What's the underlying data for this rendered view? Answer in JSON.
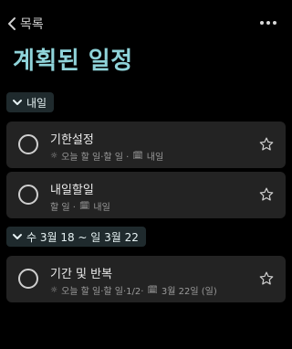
{
  "nav": {
    "back_label": "목록",
    "more_icon": "more-icon"
  },
  "page": {
    "title": "계획된 일정",
    "accent_color": "#8fd3d9"
  },
  "groups": [
    {
      "label": "내일",
      "tasks": [
        {
          "title": "기한설정",
          "meta_text": "오늘 할 일·할 일 ·",
          "due": "내일"
        },
        {
          "title": "내일할일",
          "meta_text": "할 일 ·",
          "due": "내일"
        }
      ]
    },
    {
      "label": "수 3월 18 ~ 일 3월 22",
      "tasks": [
        {
          "title": "기간 및 반복",
          "meta_text": "오늘 할 일·할 일·1/2·",
          "due": "3월 22일 (일)"
        }
      ]
    }
  ]
}
